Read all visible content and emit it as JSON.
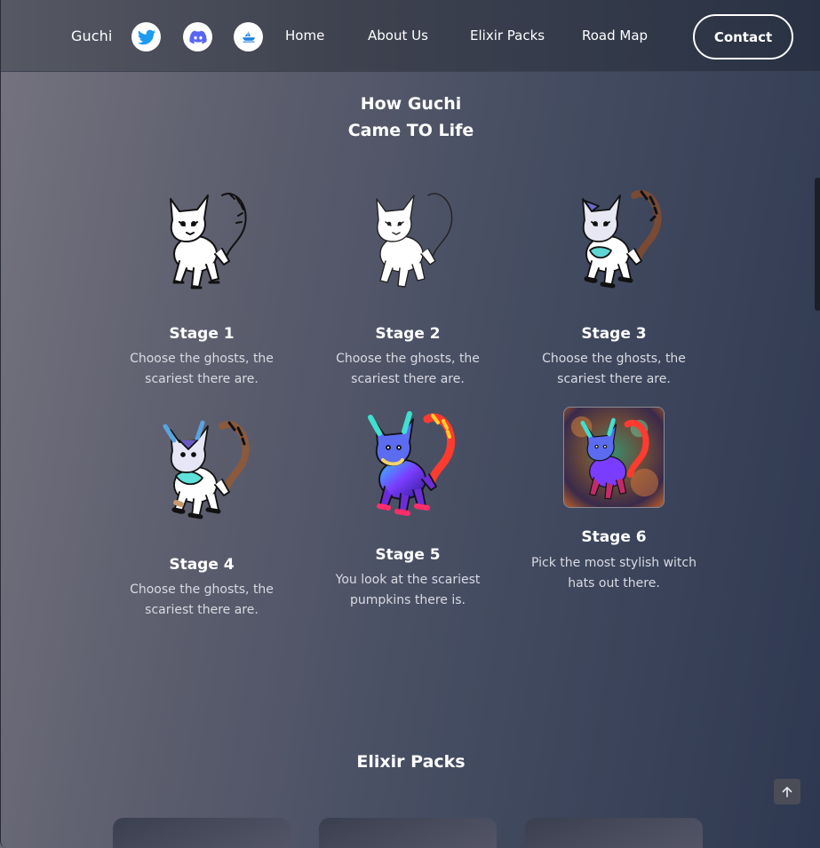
{
  "nav": {
    "brand": "Guchi",
    "social": [
      {
        "icon": "twitter-icon",
        "color": "#1d9bf0"
      },
      {
        "icon": "discord-icon",
        "color": "#5865f2"
      },
      {
        "icon": "opensea-icon",
        "color": "#2081e2"
      }
    ],
    "links": [
      "Home",
      "About Us",
      "Elixir Packs",
      "Road Map"
    ],
    "contact_label": "Contact"
  },
  "how": {
    "title_line1": "How Guchi",
    "title_line2": "Came TO Life"
  },
  "stages": [
    {
      "name": "Stage 1",
      "desc": "Choose the ghosts, the scariest there are."
    },
    {
      "name": "Stage 2",
      "desc": "Choose the ghosts, the scariest there are."
    },
    {
      "name": "Stage 3",
      "desc": "Choose the ghosts, the scariest there are."
    },
    {
      "name": "Stage 4",
      "desc": "Choose the ghosts, the scariest there are."
    },
    {
      "name": "Stage 5",
      "desc": "You look at the scariest pumpkins there is."
    },
    {
      "name": "Stage 6",
      "desc": "Pick the most stylish witch hats out there."
    }
  ],
  "elixir": {
    "title": "Elixir Packs"
  },
  "colors": {
    "accent_white": "#ffffff",
    "nav_dark": "#293244"
  }
}
